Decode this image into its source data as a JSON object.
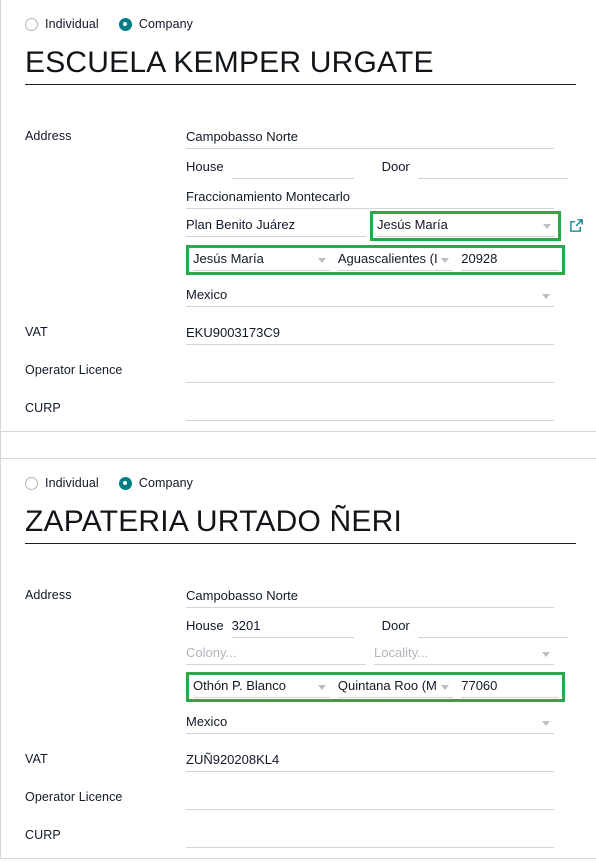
{
  "theme": {
    "accent": "#017e84",
    "highlight": "#2ba84a",
    "text": "#111827",
    "placeholder": "#b0b4bb",
    "underline": "#cfd3da",
    "card_border": "#d3d7de"
  },
  "records": [
    {
      "id": "record-1",
      "type_options": [
        {
          "label": "Individual",
          "selected": false
        },
        {
          "label": "Company",
          "selected": true
        }
      ],
      "title": "ESCUELA KEMPER URGATE",
      "fields": {
        "address_label": "Address",
        "street": "Campobasso Norte",
        "house_label": "House",
        "house": "",
        "door_label": "Door",
        "door": "",
        "street2": "Fraccionamiento Montecarlo",
        "colony": "Plan Benito Juárez",
        "colony_placeholder": "Colony...",
        "locality": "Jesús María",
        "locality_placeholder": "Locality...",
        "city": "Jesús María",
        "state": "Aguascalientes (I",
        "zip": "20928",
        "country": "Mexico",
        "vat_label": "VAT",
        "vat": "EKU9003173C9",
        "operator_licence_label": "Operator Licence",
        "operator_licence": "",
        "curp_label": "CURP",
        "curp": ""
      },
      "highlights": {
        "locality": true,
        "city_state_zip": true
      },
      "external_link_icon": "external-link-icon"
    },
    {
      "id": "record-2",
      "type_options": [
        {
          "label": "Individual",
          "selected": false
        },
        {
          "label": "Company",
          "selected": true
        }
      ],
      "title": "ZAPATERIA URTADO ÑERI",
      "fields": {
        "address_label": "Address",
        "street": "Campobasso Norte",
        "house_label": "House",
        "house": "3201",
        "door_label": "Door",
        "door": "",
        "street2": "",
        "colony": "",
        "colony_placeholder": "Colony...",
        "locality": "",
        "locality_placeholder": "Locality...",
        "city": "Othón P. Blanco",
        "state": "Quintana Roo (M",
        "zip": "77060",
        "country": "Mexico",
        "vat_label": "VAT",
        "vat": "ZUÑ920208KL4",
        "operator_licence_label": "Operator Licence",
        "operator_licence": "",
        "curp_label": "CURP",
        "curp": ""
      },
      "highlights": {
        "locality": false,
        "city_state_zip": true
      },
      "external_link_icon": null
    }
  ]
}
